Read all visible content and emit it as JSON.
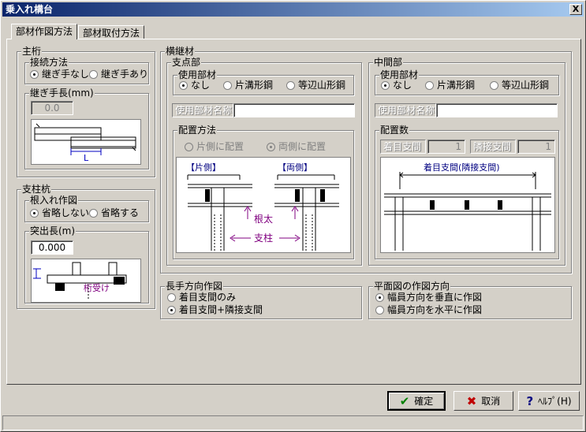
{
  "window": {
    "title": "乗入れ構台",
    "close_symbol": "X"
  },
  "tabs": [
    {
      "label": "部材作図方法"
    },
    {
      "label": "部材取付方法"
    }
  ],
  "main_girder": {
    "caption": "主桁",
    "joint": {
      "caption": "接続方法",
      "options": [
        "継ぎ手なし",
        "継ぎ手あり"
      ],
      "selected": 0
    },
    "joint_length": {
      "caption": "継ぎ手長(mm)",
      "value": "0.0",
      "diagram_label": "L"
    }
  },
  "post": {
    "caption": "支柱杭",
    "root_drawing": {
      "caption": "根入れ作図",
      "options": [
        "省略しない",
        "省略する"
      ],
      "selected": 0
    },
    "protrusion": {
      "caption": "突出長(m)",
      "value": "0.000",
      "diagram_label": "桁受け"
    }
  },
  "cross_beam": {
    "caption": "横継材",
    "support": {
      "caption": "支点部",
      "material": {
        "caption": "使用部材",
        "options": [
          "なし",
          "片溝形鋼",
          "等辺山形鋼"
        ],
        "selected": 0
      },
      "material_name_label": "使用部材名称",
      "material_name_value": "",
      "placement": {
        "caption": "配置方法",
        "options": [
          "片側に配置",
          "両側に配置"
        ],
        "selected": 1,
        "disabled": true
      },
      "diagram": {
        "one_side": "【片側】",
        "both_sides": "【両側】",
        "root_length": "根太",
        "post": "支柱"
      }
    },
    "middle": {
      "caption": "中間部",
      "material": {
        "caption": "使用部材",
        "options": [
          "なし",
          "片溝形鋼",
          "等辺山形鋼"
        ],
        "selected": 0
      },
      "material_name_label": "使用部材名称",
      "material_name_value": "",
      "count": {
        "caption": "配置数",
        "target_label": "着目支間",
        "target_value": "1",
        "adjacent_label": "隣接支間",
        "adjacent_value": "1"
      },
      "diagram": {
        "label": "着目支間(隣接支間)"
      }
    }
  },
  "long_dir": {
    "caption": "長手方向作図",
    "options": [
      "着目支間のみ",
      "着目支間+隣接支間"
    ],
    "selected": 1
  },
  "plan_dir": {
    "caption": "平面図の作図方向",
    "options": [
      "幅員方向を垂直に作図",
      "幅員方向を水平に作図"
    ],
    "selected": 0
  },
  "buttons": {
    "ok": {
      "label": "確定",
      "icon": "✔"
    },
    "cancel": {
      "label": "取消",
      "icon": "✖"
    },
    "help": {
      "label": "ﾍﾙﾌﾟ(H)",
      "icon": "?"
    }
  },
  "colors": {
    "titlebar_start": "#0a246a",
    "titlebar_end": "#a6caf0",
    "ok_icon": "#008000",
    "cancel_icon": "#c00000",
    "help_icon": "#000080",
    "diagram_accent": "#800080",
    "dim_line": "#0000c0"
  }
}
